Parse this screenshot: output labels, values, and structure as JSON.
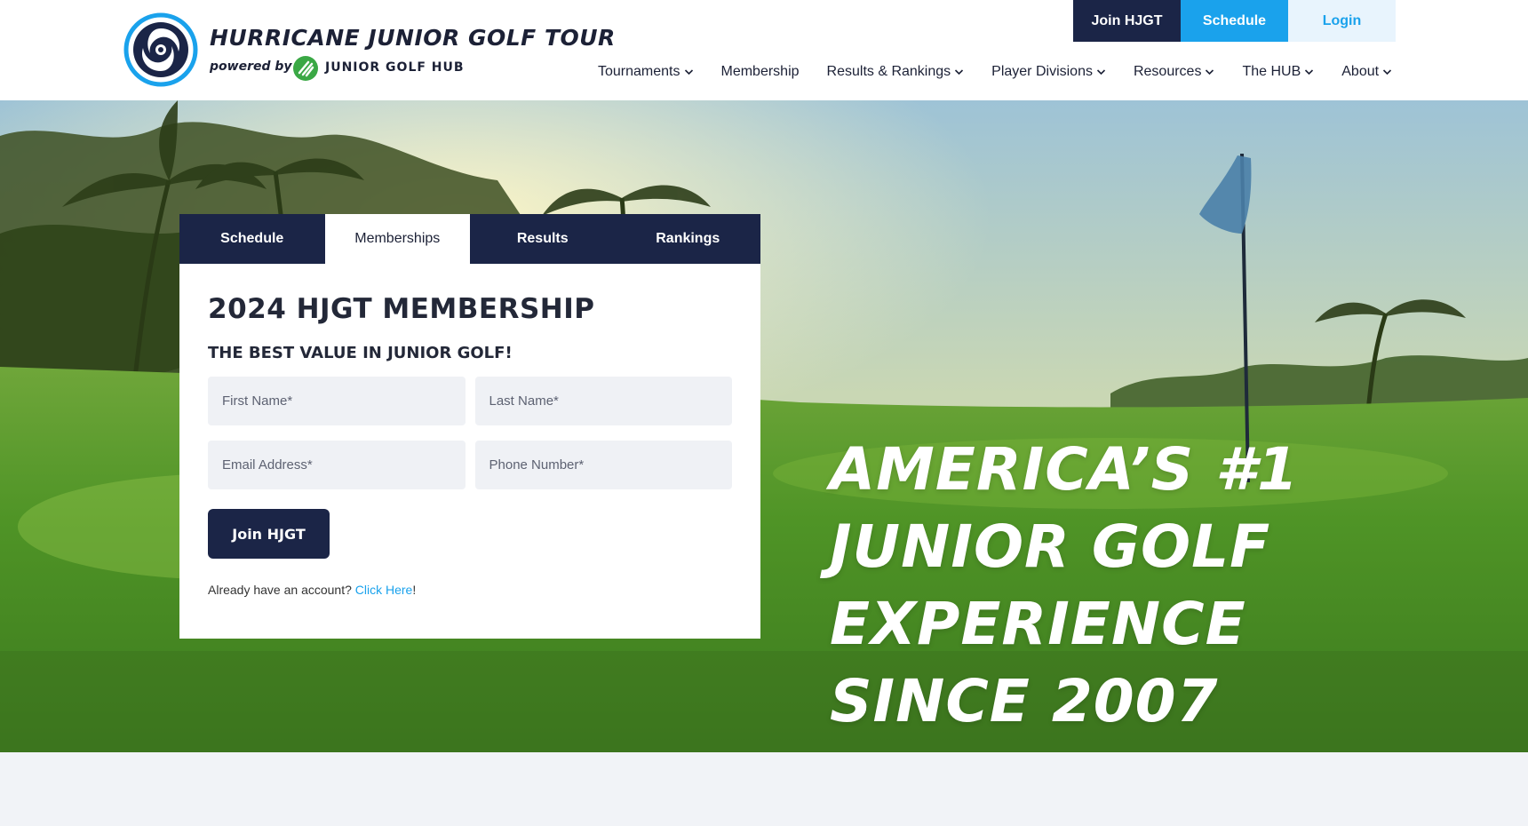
{
  "brand": {
    "title": "HURRICANE JUNIOR GOLF TOUR",
    "powered_by": "powered by",
    "hub_name": "JUNIOR GOLF HUB"
  },
  "top_actions": {
    "join": "Join HJGT",
    "schedule": "Schedule",
    "login": "Login"
  },
  "nav": {
    "items": [
      {
        "label": "Tournaments",
        "dropdown": true
      },
      {
        "label": "Membership",
        "dropdown": false
      },
      {
        "label": "Results & Rankings",
        "dropdown": true
      },
      {
        "label": "Player Divisions",
        "dropdown": true
      },
      {
        "label": "Resources",
        "dropdown": true
      },
      {
        "label": "The HUB",
        "dropdown": true
      },
      {
        "label": "About",
        "dropdown": true
      }
    ]
  },
  "card": {
    "tabs": [
      "Schedule",
      "Memberships",
      "Results",
      "Rankings"
    ],
    "active_tab": "Memberships",
    "title": "2024 HJGT MEMBERSHIP",
    "subtitle": "THE BEST VALUE IN JUNIOR GOLF!",
    "fields": {
      "first_name": {
        "placeholder": "First Name*",
        "value": ""
      },
      "last_name": {
        "placeholder": "Last Name*",
        "value": ""
      },
      "email": {
        "placeholder": "Email Address*",
        "value": ""
      },
      "phone": {
        "placeholder": "Phone Number*",
        "value": ""
      }
    },
    "submit_label": "Join HJGT",
    "account_prompt": "Already have an account?",
    "account_link": "Click Here",
    "account_suffix": "!"
  },
  "hero": {
    "headline": [
      "AMERICA’S #1",
      "JUNIOR GOLF",
      "EXPERIENCE",
      "SINCE 2007"
    ]
  },
  "colors": {
    "navy": "#1b2547",
    "accent_blue": "#1aa2ec",
    "login_bg": "#e8f4fd",
    "text_dark": "#1c2136",
    "page_bg": "#f1f3f7"
  }
}
